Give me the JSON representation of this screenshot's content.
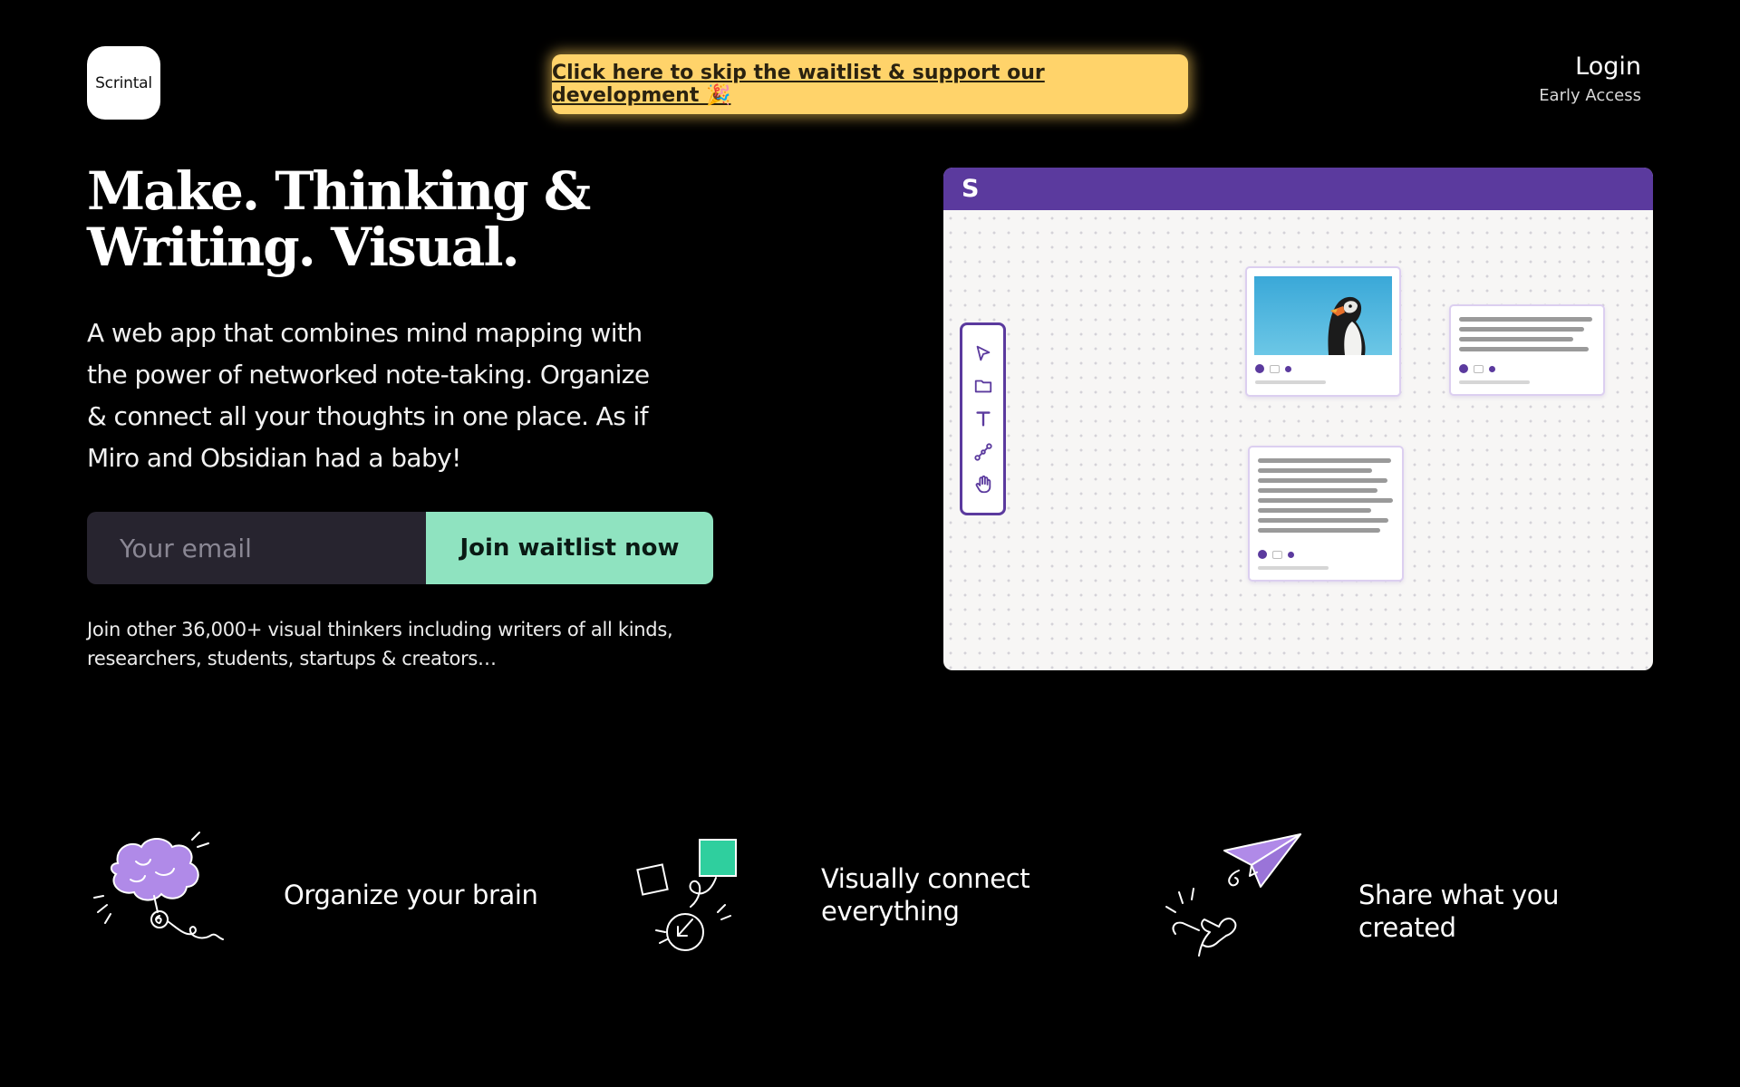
{
  "header": {
    "logo_text": "Scrintal",
    "promo_text": "Click here to skip the waitlist & support our development 🎉",
    "login_label": "Login",
    "login_sublabel": "Early Access"
  },
  "hero": {
    "title_line1": "Make. Thinking &",
    "title_line2": "Writing. Visual.",
    "description": "A web app that combines mind mapping with the power of networked note-taking. Organize & connect all your thoughts in one place.  As if Miro and Obsidian had a baby!",
    "email_placeholder": "Your email",
    "email_value": "",
    "join_button_label": "Join waitlist now",
    "social_proof": "Join other 36,000+ visual thinkers including writers of all kinds, researchers, students, startups & creators…"
  },
  "mockup": {
    "bar_letter": "S",
    "tools": [
      "cursor-icon",
      "folder-icon",
      "text-icon",
      "connect-icon",
      "hand-icon"
    ]
  },
  "features": [
    {
      "label": "Organize your brain",
      "icon": "brain-illustration-icon"
    },
    {
      "label_line1": "Visually connect",
      "label_line2": "everything",
      "icon": "connect-shapes-illustration-icon"
    },
    {
      "label": "Share what you created",
      "icon": "paper-plane-illustration-icon"
    }
  ],
  "colors": {
    "background": "#000000",
    "promo": "#ffd36a",
    "accent_green": "#8fe3c0",
    "purple": "#5b3a9e",
    "input_bg": "#27242f"
  }
}
